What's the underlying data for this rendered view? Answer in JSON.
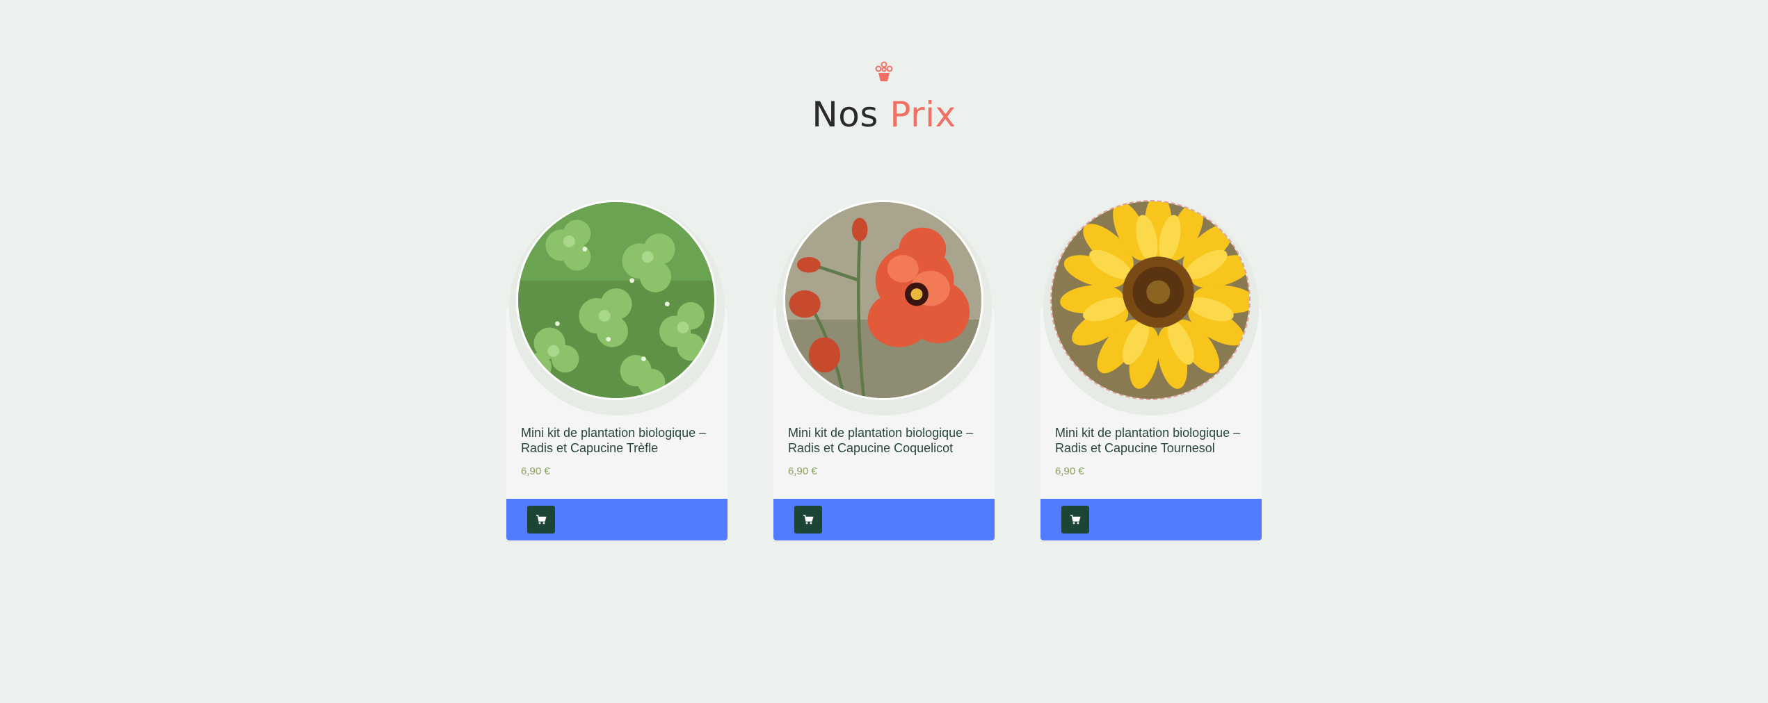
{
  "header": {
    "icon": "flower-pot-icon",
    "title_main": "Nos",
    "title_accent": "Prix",
    "accent_color": "#f07066"
  },
  "products": [
    {
      "name": "Mini kit de plantation biologique – Radis et Capucine Trèfle",
      "price": "6,90 €",
      "image": "clover-leaves-photo",
      "cart_icon": "shopping-cart-icon"
    },
    {
      "name": "Mini kit de plantation biologique – Radis et Capucine Coquelicot",
      "price": "6,90 €",
      "image": "red-poppy-photo",
      "cart_icon": "shopping-cart-icon"
    },
    {
      "name": "Mini kit de plantation biologique – Radis et Capucine Tournesol",
      "price": "6,90 €",
      "image": "sunflower-photo",
      "cart_icon": "shopping-cart-icon"
    }
  ],
  "colors": {
    "background": "#edf1ed",
    "card": "#f5f5f5",
    "cart_bar": "#527cfd",
    "cart_button": "#1d4536",
    "price": "#8aa35b",
    "product_name": "#29453f"
  }
}
